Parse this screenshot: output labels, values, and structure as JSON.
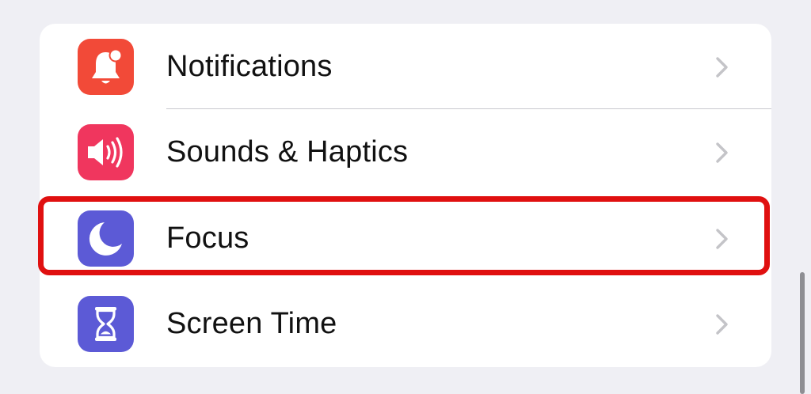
{
  "settings": {
    "rows": [
      {
        "label": "Notifications",
        "icon": "bell-icon",
        "icon_color": "#f24a38"
      },
      {
        "label": "Sounds & Haptics",
        "icon": "speaker-icon",
        "icon_color": "#f0365e"
      },
      {
        "label": "Focus",
        "icon": "moon-icon",
        "icon_color": "#5c5ad6"
      },
      {
        "label": "Screen Time",
        "icon": "hourglass-icon",
        "icon_color": "#5c5ad6"
      }
    ]
  },
  "highlight": {
    "color": "#e01010"
  },
  "colors": {
    "background": "#efeff4",
    "card": "#ffffff",
    "chevron": "#c4c4c8"
  }
}
